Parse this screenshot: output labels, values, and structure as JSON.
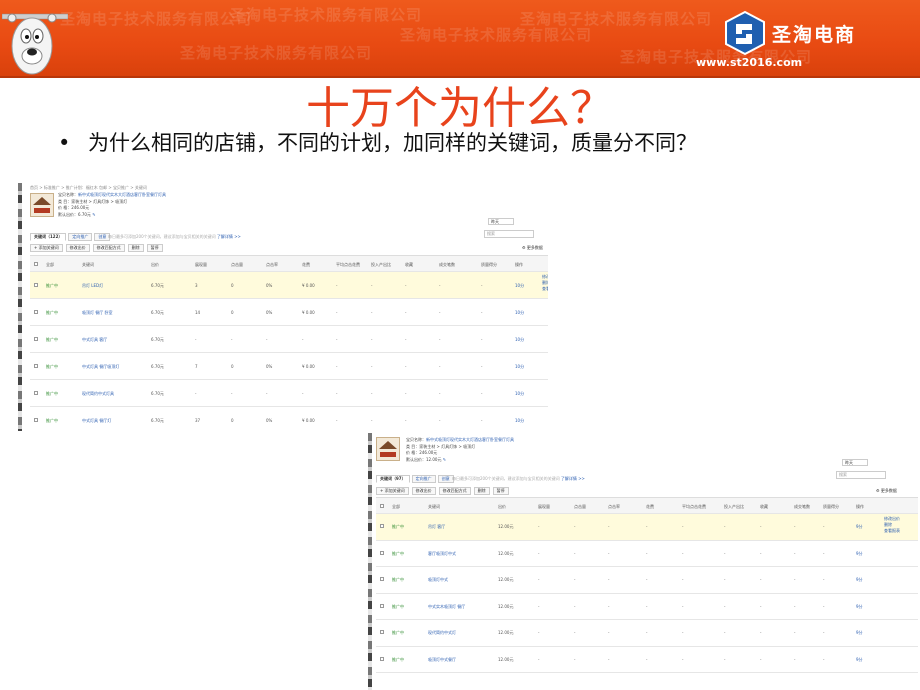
{
  "banner": {
    "watermark": "圣淘电子技术服务有限公司",
    "logo_text": "圣淘电商",
    "logo_url": "www.st2016.com",
    "accent": "#e84a12"
  },
  "slide": {
    "title": "十万个为什么？",
    "bullet_mark": "•",
    "bullet": "为什么相同的店铺，不同的计划，加同样的关键词，质量分不同？",
    "title_color": "#e8431c"
  },
  "shot1": {
    "crumbs": "首页 > 标准推广 > 推广计划：福红木 包邮 > 宝贝推广 > 关键词",
    "ad_name_label": "宝贝名称：",
    "ad_name": "新中式吸顶灯现代实木大灯酒店客厅卧室餐厅灯具",
    "category_label": "类    目：",
    "category": "家装主材 > 灯具灯饰 > 吸顶灯",
    "price_label": "价    格：",
    "price": "246.00元",
    "default_bid_label": "默认出价：",
    "default_bid": "6.70元",
    "date_label": "昨天",
    "search_placeholder": "搜索",
    "tabs": [
      "关键词（122）",
      "定向推广",
      "创意"
    ],
    "tip": "每日最多可添加200个关键词，建议添加与宝贝相关的关键词",
    "tip_link": "了解详情 >>",
    "toolbar": [
      "+ 添加关键词",
      "修改出价",
      "修改匹配方式",
      "删除",
      "暂停"
    ],
    "more": "⚙ 更多数据",
    "headers": [
      "全部",
      "关键词",
      "出价",
      "展现量",
      "点击量",
      "点击率",
      "花费",
      "平均点击花费",
      "投入产出比",
      "收藏",
      "成交笔数",
      "质量得分",
      "操作"
    ],
    "ops": [
      "修改出价",
      "删除",
      "查看报表"
    ],
    "rows": [
      {
        "status": "推广中",
        "kw": "吊灯 LED灯",
        "bid": "6.70元",
        "impr": "3",
        "click": "0",
        "ctr": "0%",
        "cost": "¥ 0.00",
        "a": "-",
        "b": "-",
        "c": "-",
        "d": "-",
        "e": "-",
        "q": "10分"
      },
      {
        "status": "推广中",
        "kw": "吸顶灯 餐厅 卧室",
        "bid": "6.70元",
        "impr": "14",
        "click": "0",
        "ctr": "0%",
        "cost": "¥ 0.00",
        "a": "-",
        "b": "-",
        "c": "-",
        "d": "-",
        "e": "-",
        "q": "10分"
      },
      {
        "status": "推广中",
        "kw": "中式灯具 客厅",
        "bid": "6.70元",
        "impr": "-",
        "click": "-",
        "ctr": "-",
        "cost": "-",
        "a": "-",
        "b": "-",
        "c": "-",
        "d": "-",
        "e": "-",
        "q": "10分"
      },
      {
        "status": "推广中",
        "kw": "中式灯具 餐厅吸顶灯",
        "bid": "6.70元",
        "impr": "7",
        "click": "0",
        "ctr": "0%",
        "cost": "¥ 0.00",
        "a": "-",
        "b": "-",
        "c": "-",
        "d": "-",
        "e": "-",
        "q": "10分"
      },
      {
        "status": "推广中",
        "kw": "现代简约中式灯具",
        "bid": "6.70元",
        "impr": "-",
        "click": "-",
        "ctr": "-",
        "cost": "-",
        "a": "-",
        "b": "-",
        "c": "-",
        "d": "-",
        "e": "-",
        "q": "10分"
      },
      {
        "status": "推广中",
        "kw": "中式灯具 餐厅灯",
        "bid": "6.70元",
        "impr": "37",
        "click": "0",
        "ctr": "0%",
        "cost": "¥ 0.00",
        "a": "-",
        "b": "-",
        "c": "-",
        "d": "-",
        "e": "-",
        "q": "10分"
      }
    ]
  },
  "shot2": {
    "ad_name_label": "宝贝名称：",
    "ad_name": "新中式吸顶灯现代实木大灯酒店客厅卧室餐厅灯具",
    "category_label": "类    目：",
    "category": "家装主材 > 灯具灯饰 > 吸顶灯",
    "price_label": "价    格：",
    "price": "246.00元",
    "default_bid_label": "默认出价：",
    "default_bid": "12.00元",
    "date_label": "昨天",
    "search_placeholder": "搜索",
    "tabs": [
      "关键词（97）",
      "定向推广",
      "创意"
    ],
    "tip": "每日最多可添加200个关键词，建议添加与宝贝相关的关键词",
    "tip_link": "了解详情 >>",
    "toolbar": [
      "+ 添加关键词",
      "修改出价",
      "修改匹配方式",
      "删除",
      "暂停"
    ],
    "more": "⚙ 更多数据",
    "headers": [
      "全部",
      "关键词",
      "出价",
      "展现量",
      "点击量",
      "点击率",
      "花费",
      "平均点击花费",
      "投入产出比",
      "收藏",
      "成交笔数",
      "质量得分",
      "操作"
    ],
    "ops": [
      "修改出价",
      "删除",
      "查看报表"
    ],
    "rows": [
      {
        "status": "推广中",
        "kw": "吊灯 客厅",
        "bid": "12.00元",
        "impr": "-",
        "click": "-",
        "ctr": "-",
        "cost": "-",
        "a": "-",
        "b": "-",
        "c": "-",
        "d": "-",
        "e": "-",
        "q": "9分"
      },
      {
        "status": "推广中",
        "kw": "客厅吸顶灯中式",
        "bid": "12.00元",
        "impr": "-",
        "click": "-",
        "ctr": "-",
        "cost": "-",
        "a": "-",
        "b": "-",
        "c": "-",
        "d": "-",
        "e": "-",
        "q": "9分"
      },
      {
        "status": "推广中",
        "kw": "吸顶灯中式",
        "bid": "12.00元",
        "impr": "-",
        "click": "-",
        "ctr": "-",
        "cost": "-",
        "a": "-",
        "b": "-",
        "c": "-",
        "d": "-",
        "e": "-",
        "q": "9分"
      },
      {
        "status": "推广中",
        "kw": "中式实木吸顶灯 餐厅",
        "bid": "12.00元",
        "impr": "-",
        "click": "-",
        "ctr": "-",
        "cost": "-",
        "a": "-",
        "b": "-",
        "c": "-",
        "d": "-",
        "e": "-",
        "q": "9分"
      },
      {
        "status": "推广中",
        "kw": "现代简约中式灯",
        "bid": "12.00元",
        "impr": "-",
        "click": "-",
        "ctr": "-",
        "cost": "-",
        "a": "-",
        "b": "-",
        "c": "-",
        "d": "-",
        "e": "-",
        "q": "9分"
      },
      {
        "status": "推广中",
        "kw": "吸顶灯中式餐厅",
        "bid": "12.00元",
        "impr": "-",
        "click": "-",
        "ctr": "-",
        "cost": "-",
        "a": "-",
        "b": "-",
        "c": "-",
        "d": "-",
        "e": "-",
        "q": "9分"
      }
    ]
  }
}
